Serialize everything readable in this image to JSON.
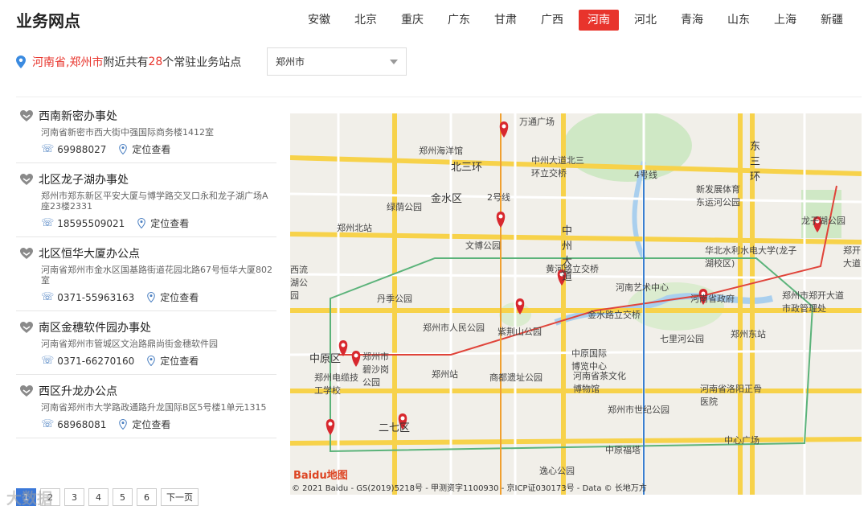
{
  "header": {
    "title": "业务网点"
  },
  "provinces": [
    "安徽",
    "北京",
    "重庆",
    "广东",
    "甘肃",
    "广西",
    "河南",
    "河北",
    "青海",
    "山东",
    "上海",
    "新疆"
  ],
  "active_province": "河南",
  "location": {
    "region": "河南省,郑州市",
    "prefix": " 附近共有",
    "count": "28",
    "suffix": "个常驻业务站点"
  },
  "city_select": {
    "value": "郑州市"
  },
  "offices": [
    {
      "name": "西南新密办事处",
      "address": "河南省新密市西大街中强国际商务楼1412室",
      "phone": "69988027",
      "locate": "定位查看"
    },
    {
      "name": "北区龙子湖办事处",
      "address": "郑州市郑东新区平安大厦与博学路交叉口永和龙子湖广场A座23楼2331",
      "phone": "18595509021",
      "locate": "定位查看"
    },
    {
      "name": "北区恒华大厦办公点",
      "address": "河南省郑州市金水区国基路街道花园北路67号恒华大厦802室",
      "phone": "0371-55963163",
      "locate": "定位查看"
    },
    {
      "name": "南区金穗软件园办事处",
      "address": "河南省郑州市管城区文治路鼎尚街金穗软件园",
      "phone": "0371-66270160",
      "locate": "定位查看"
    },
    {
      "name": "西区升龙办公点",
      "address": "河南省郑州市大学路政通路升龙国际B区5号楼1单元1315",
      "phone": "68968081",
      "locate": "定位查看"
    }
  ],
  "pager": {
    "pages": [
      "1",
      "2",
      "3",
      "4",
      "5",
      "6"
    ],
    "current": "1",
    "next": "下一页"
  },
  "watermark": "大数据",
  "map": {
    "logo": "Baidu地图",
    "copyright": "© 2021 Baidu - GS(2019)5218号 - 甲测资字1100930 - 京ICP证030173号 - Data © 长地万方",
    "labels": {
      "l1": "万通广场",
      "l2": "郑州海洋馆",
      "l3": "北三环",
      "l4": "中州大道北三环立交桥",
      "l5": "4号线",
      "l6": "新发展体育东运河公园",
      "l7": "东三环",
      "l8": "金水区",
      "l9": "2号线",
      "l10": "绿荫公园",
      "l11": "郑州北站",
      "l12": "文博公园",
      "l13": "中州大道",
      "l14": "龙子湖公园",
      "l15": "华北水利水电大学(龙子湖校区)",
      "l16": "郑开大道",
      "l17": "黄河路立交桥",
      "l18": "河南艺术中心",
      "l19": "河南省政府",
      "l20": "郑州市郑开大道市政管理处",
      "l21": "丹季公园",
      "l22": "金水路立交桥",
      "l23": "郑州市人民公园",
      "l24": "紫荆山公园",
      "l25": "七里河公园",
      "l26": "郑州东站",
      "l27": "中原区",
      "l28": "郑州市碧沙岗公园",
      "l29": "郑州站",
      "l30": "中原国际博览中心",
      "l31": "河南省茶文化博物馆",
      "l32": "商都遗址公园",
      "l33": "郑州电缆技工学校",
      "l34": "河南省洛阳正骨医院",
      "l35": "郑州市世纪公园",
      "l36": "二七区",
      "l37": "中原福塔",
      "l38": "中心广场",
      "l39": "逸心公园",
      "l40": "西流湖公园"
    }
  }
}
